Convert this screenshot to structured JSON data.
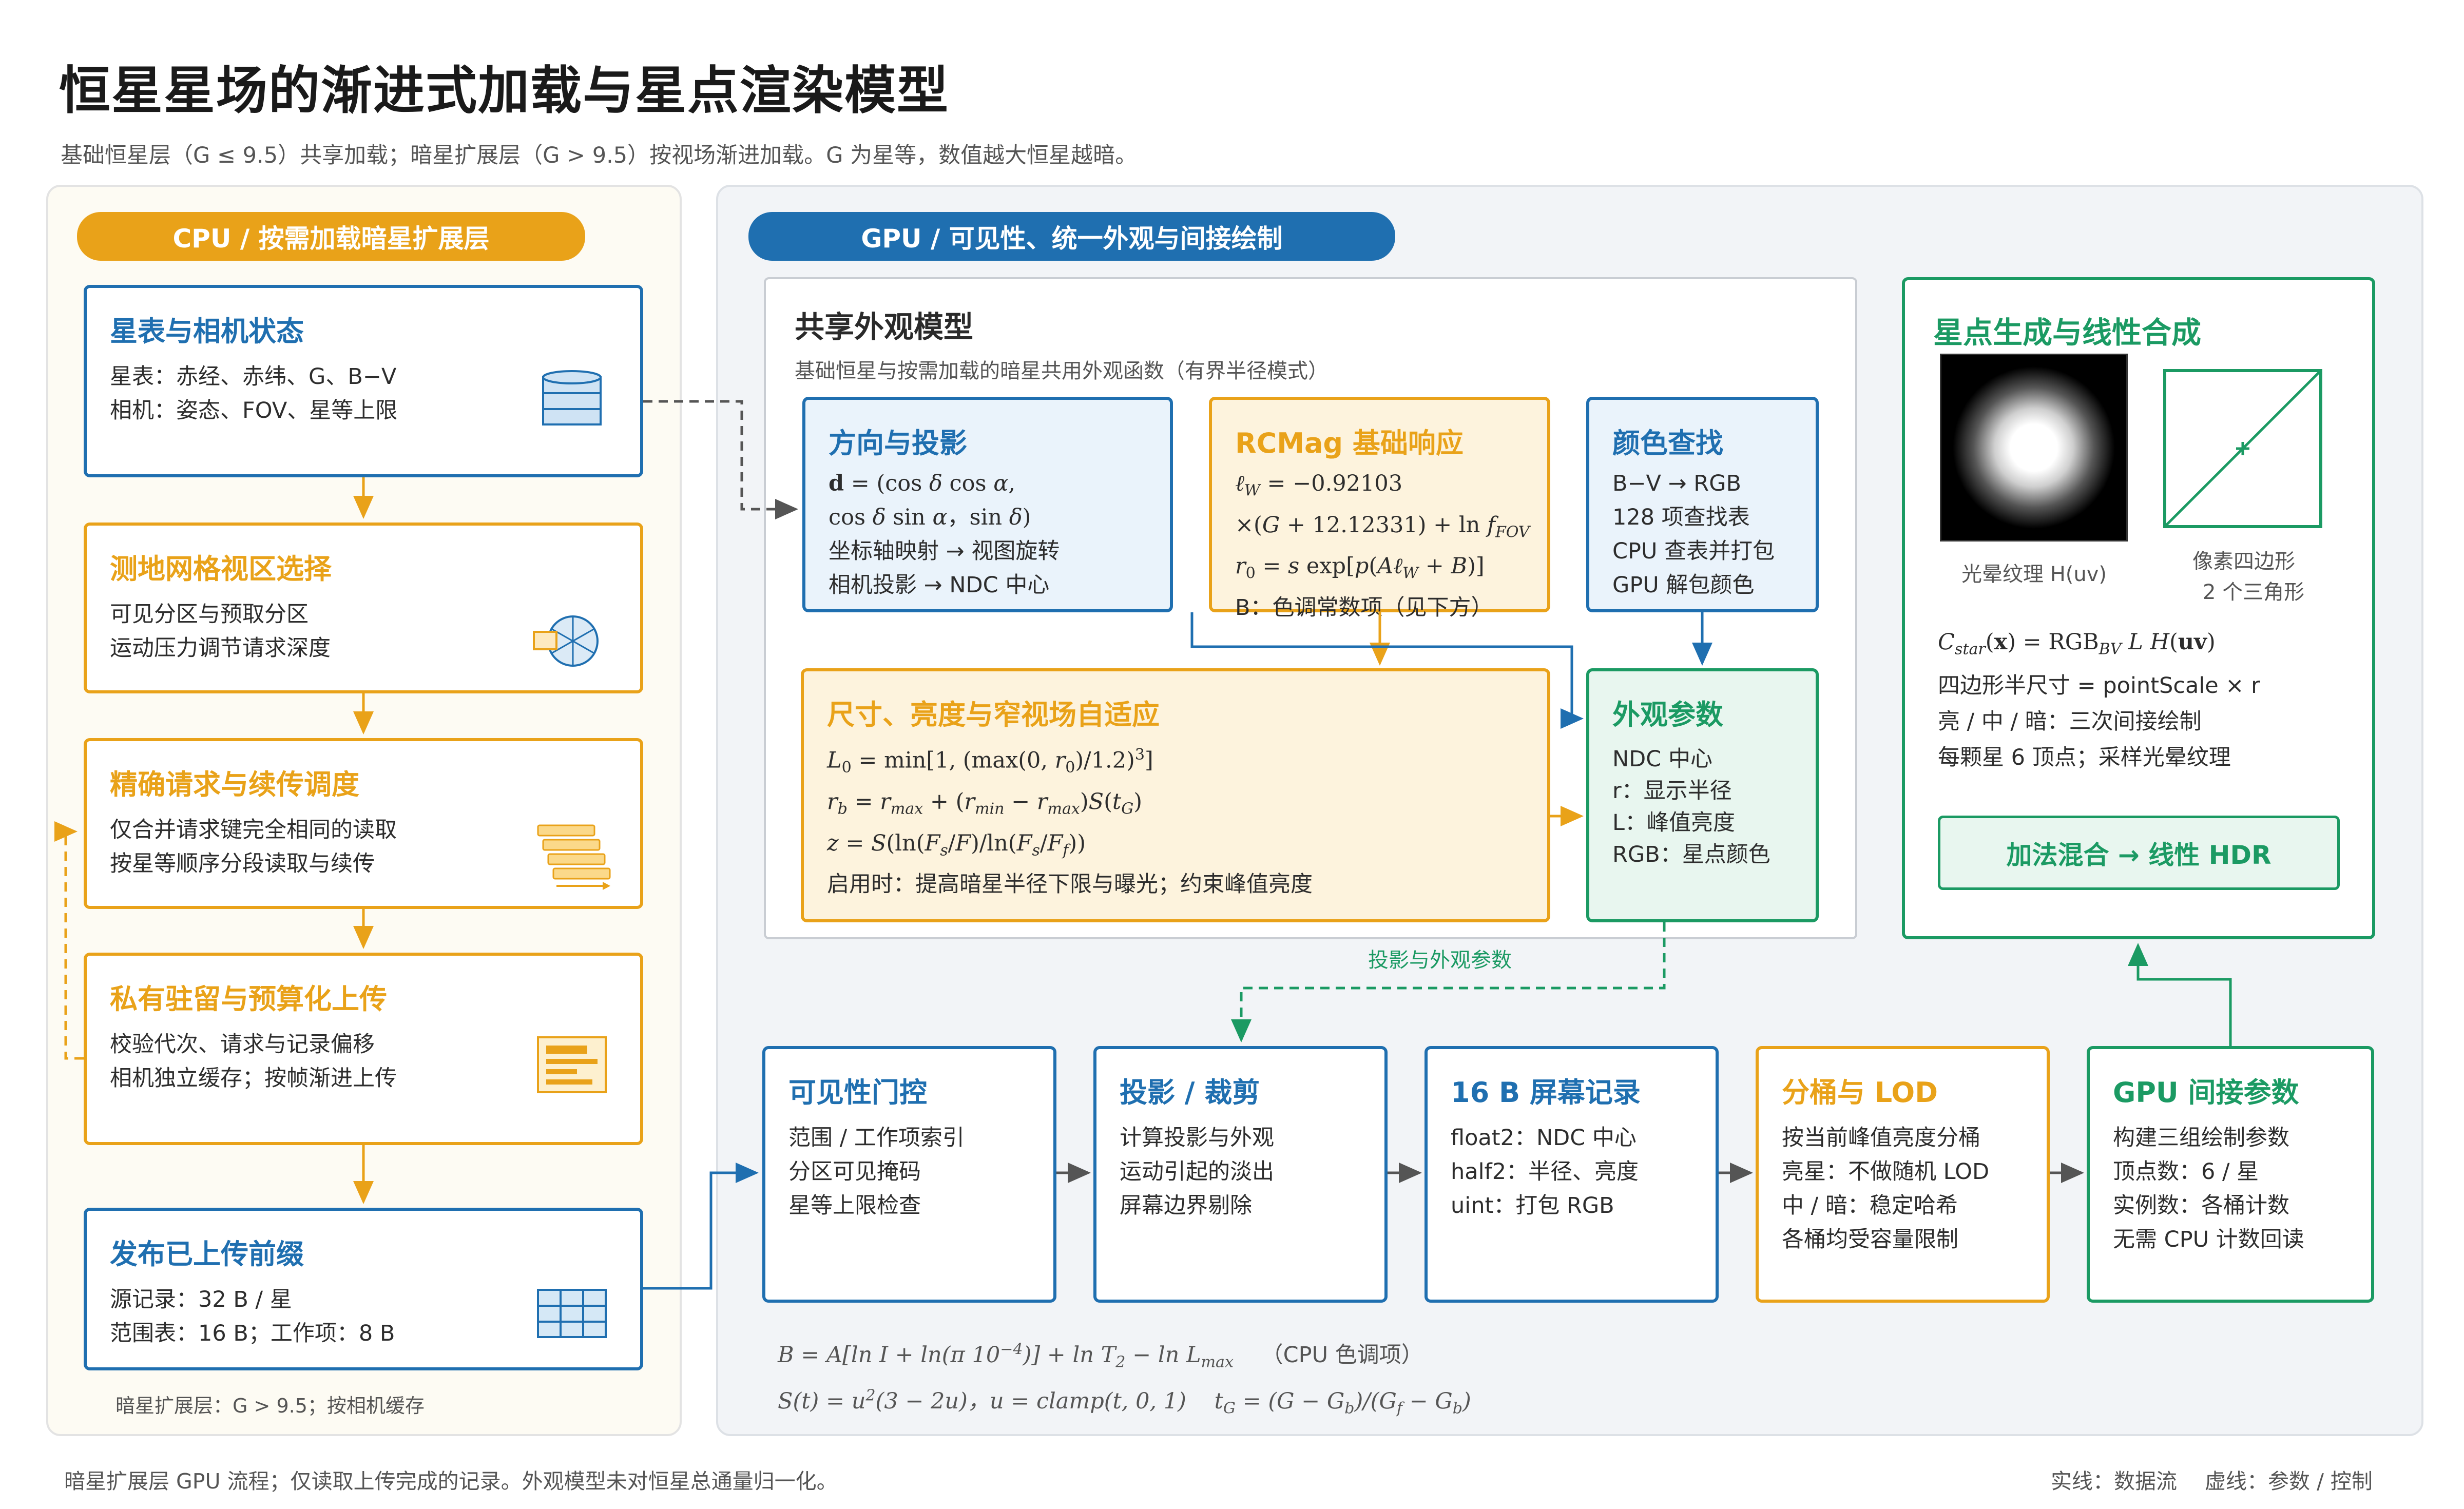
{
  "title": "恒星星场的渐进式加载与星点渲染模型",
  "subtitle": "基础恒星层（G ≤ 9.5）共享加载；暗星扩展层（G > 9.5）按视场渐进加载。G 为星等，数值越大恒星越暗。",
  "cpu": {
    "header": "CPU / 按需加载暗星扩展层",
    "cards": [
      {
        "title": "星表与相机状态",
        "lines": [
          "星表：赤经、赤纬、G、B−V",
          "相机：姿态、FOV、星等上限"
        ],
        "icon": "database-icon"
      },
      {
        "title": "测地网格视区选择",
        "lines": [
          "可见分区与预取分区",
          "运动压力调节请求深度"
        ],
        "icon": "geodesic-grid-icon"
      },
      {
        "title": "精确请求与续传调度",
        "lines": [
          "仅合并请求键完全相同的读取",
          "按星等顺序分段读取与续传"
        ],
        "icon": "stacked-requests-icon"
      },
      {
        "title": "私有驻留与预算化上传",
        "lines": [
          "校验代次、请求与记录偏移",
          "相机独立缓存；按帧渐进上传"
        ],
        "icon": "document-icon"
      },
      {
        "title": "发布已上传前缀",
        "lines": [
          "源记录：32 B / 星",
          "范围表：16 B；工作项：8 B"
        ],
        "icon": "table-icon"
      }
    ],
    "footnote": "暗星扩展层：G > 9.5；按相机缓存"
  },
  "gpu": {
    "header": "GPU / 可见性、统一外观与间接绘制",
    "shared_title": "共享外观模型",
    "shared_subtitle": "基础恒星与按需加载的暗星共用外观函数（有界半径模式）",
    "projection": {
      "title": "方向与投影",
      "lines": [
        "坐标轴映射 → 视图旋转",
        "相机投影 → NDC 中心"
      ]
    },
    "rcmag": {
      "title": "RCMag 基础响应",
      "line4": "B：色调常数项（见下方）"
    },
    "color": {
      "title": "颜色查找",
      "lines": [
        "B−V → RGB",
        "128 项查找表",
        "CPU 查表并打包",
        "GPU 解包颜色"
      ]
    },
    "size": {
      "title": "尺寸、亮度与窄视场自适应",
      "line4": "启用时：提高暗星半径下限与曝光；约束峰值亮度"
    },
    "appearance": {
      "title": "外观参数",
      "lines": [
        "NDC 中心",
        "r：显示半径",
        "L：峰值亮度",
        "RGB：星点颜色"
      ]
    },
    "composite": {
      "title": "星点生成与线性合成",
      "halo_caption": "光晕纹理 H(uv)",
      "quad_caption_1": "像素四边形",
      "quad_caption_2": "2 个三角形",
      "lines": [
        "四边形半尺寸 = pointScale × r",
        "亮 / 中 / 暗：三次间接绘制",
        "每颗星 6 顶点；采样光晕纹理"
      ],
      "blend_button": "加法混合 → 线性 HDR"
    },
    "edge_label": "投影与外观参数",
    "pipeline": [
      {
        "title": "可见性门控",
        "lines": [
          "范围 / 工作项索引",
          "分区可见掩码",
          "星等上限检查"
        ],
        "color": "blue"
      },
      {
        "title": "投影 / 裁剪",
        "lines": [
          "计算投影与外观",
          "运动引起的淡出",
          "屏幕边界剔除"
        ],
        "color": "blue"
      },
      {
        "title": "16 B 屏幕记录",
        "lines": [
          "float2：NDC 中心",
          "half2：半径、亮度",
          "uint：打包 RGB"
        ],
        "color": "blue"
      },
      {
        "title": "分桶与 LOD",
        "lines": [
          "按当前峰值亮度分桶",
          "亮星：不做随机 LOD",
          "中 / 暗：稳定哈希",
          "各桶均受容量限制"
        ],
        "color": "orange"
      },
      {
        "title": "GPU 间接参数",
        "lines": [
          "构建三组绘制参数",
          "顶点数：6 / 星",
          "实例数：各桶计数",
          "无需 CPU 计数回读"
        ],
        "color": "green"
      }
    ],
    "formula_note": "（CPU 色调项）"
  },
  "footer": {
    "left": "暗星扩展层 GPU 流程；仅读取上传完成的记录。外观模型未对恒星总通量归一化。",
    "right": "实线：数据流　 虚线：参数 / 控制"
  },
  "colors": {
    "blue": "#1f6fb0",
    "orange": "#e9a219",
    "green": "#1b9a63",
    "gray": "#555555"
  }
}
